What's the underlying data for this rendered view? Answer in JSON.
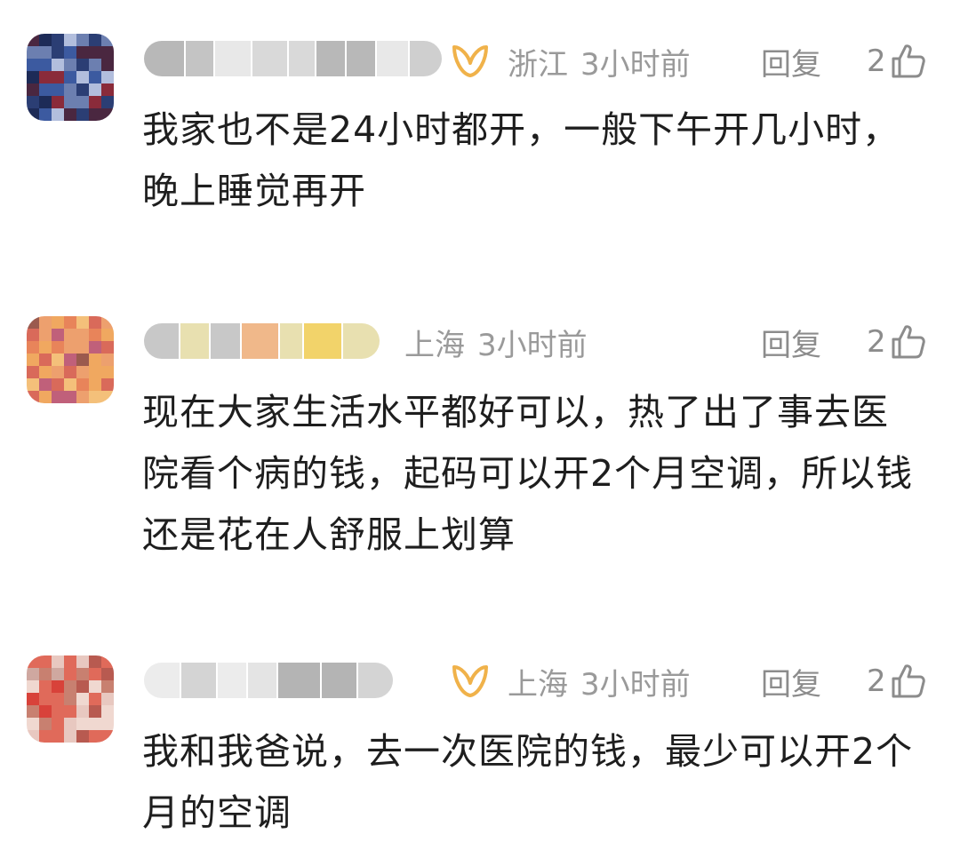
{
  "comments": [
    {
      "location": "浙江",
      "time": "3小时前",
      "reply_label": "回复",
      "likes": "2",
      "text": "我家也不是24小时都开，一般下午开几小时，晚上睡觉再开",
      "vip": true
    },
    {
      "location": "上海",
      "time": "3小时前",
      "reply_label": "回复",
      "likes": "2",
      "text": "现在大家生活水平都好可以，热了出了事去医院看个病的钱，起码可以开2个月空调，所以钱还是花在人舒服上划算",
      "vip": false
    },
    {
      "location": "上海",
      "time": "3小时前",
      "reply_label": "回复",
      "likes": "2",
      "text": "我和我爸说，去一次医院的钱，最少可以开2个月的空调",
      "vip": true
    }
  ],
  "colors": {
    "meta_text": "#9a9a9a",
    "body_text": "#1e1e1e",
    "vip_gold": "#f0b24a"
  },
  "icons": {
    "vip": "vip-badge-icon",
    "like": "thumbs-up-icon"
  }
}
